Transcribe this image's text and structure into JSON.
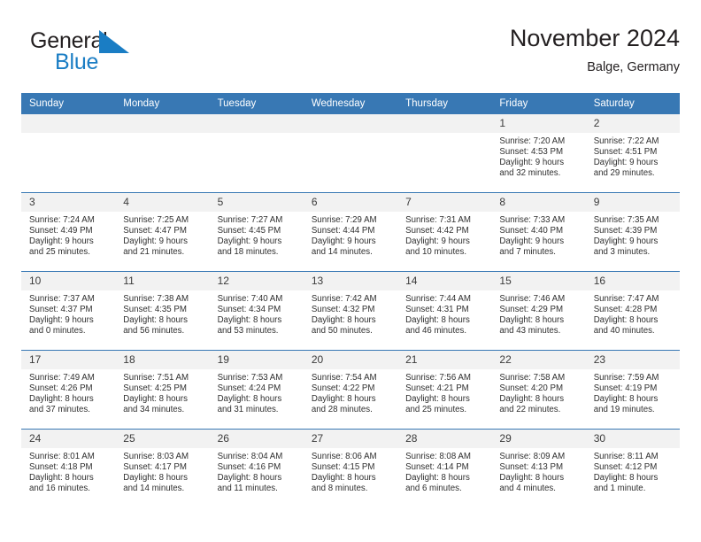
{
  "brand": {
    "name_part1": "General",
    "name_part2": "Blue",
    "logo_icon": "blue-triangle-icon",
    "accent_color": "#1a7dc4"
  },
  "header": {
    "title": "November 2024",
    "subtitle": "Balge, Germany"
  },
  "calendar": {
    "header_bg_color": "#3878b4",
    "daynum_bg_color": "#f2f2f2",
    "weekdays": [
      "Sunday",
      "Monday",
      "Tuesday",
      "Wednesday",
      "Thursday",
      "Friday",
      "Saturday"
    ],
    "weeks": [
      [
        {
          "day": "",
          "empty": true
        },
        {
          "day": "",
          "empty": true
        },
        {
          "day": "",
          "empty": true
        },
        {
          "day": "",
          "empty": true
        },
        {
          "day": "",
          "empty": true
        },
        {
          "day": "1",
          "sunrise": "Sunrise: 7:20 AM",
          "sunset": "Sunset: 4:53 PM",
          "daylight_1": "Daylight: 9 hours",
          "daylight_2": "and 32 minutes."
        },
        {
          "day": "2",
          "sunrise": "Sunrise: 7:22 AM",
          "sunset": "Sunset: 4:51 PM",
          "daylight_1": "Daylight: 9 hours",
          "daylight_2": "and 29 minutes."
        }
      ],
      [
        {
          "day": "3",
          "sunrise": "Sunrise: 7:24 AM",
          "sunset": "Sunset: 4:49 PM",
          "daylight_1": "Daylight: 9 hours",
          "daylight_2": "and 25 minutes."
        },
        {
          "day": "4",
          "sunrise": "Sunrise: 7:25 AM",
          "sunset": "Sunset: 4:47 PM",
          "daylight_1": "Daylight: 9 hours",
          "daylight_2": "and 21 minutes."
        },
        {
          "day": "5",
          "sunrise": "Sunrise: 7:27 AM",
          "sunset": "Sunset: 4:45 PM",
          "daylight_1": "Daylight: 9 hours",
          "daylight_2": "and 18 minutes."
        },
        {
          "day": "6",
          "sunrise": "Sunrise: 7:29 AM",
          "sunset": "Sunset: 4:44 PM",
          "daylight_1": "Daylight: 9 hours",
          "daylight_2": "and 14 minutes."
        },
        {
          "day": "7",
          "sunrise": "Sunrise: 7:31 AM",
          "sunset": "Sunset: 4:42 PM",
          "daylight_1": "Daylight: 9 hours",
          "daylight_2": "and 10 minutes."
        },
        {
          "day": "8",
          "sunrise": "Sunrise: 7:33 AM",
          "sunset": "Sunset: 4:40 PM",
          "daylight_1": "Daylight: 9 hours",
          "daylight_2": "and 7 minutes."
        },
        {
          "day": "9",
          "sunrise": "Sunrise: 7:35 AM",
          "sunset": "Sunset: 4:39 PM",
          "daylight_1": "Daylight: 9 hours",
          "daylight_2": "and 3 minutes."
        }
      ],
      [
        {
          "day": "10",
          "sunrise": "Sunrise: 7:37 AM",
          "sunset": "Sunset: 4:37 PM",
          "daylight_1": "Daylight: 9 hours",
          "daylight_2": "and 0 minutes."
        },
        {
          "day": "11",
          "sunrise": "Sunrise: 7:38 AM",
          "sunset": "Sunset: 4:35 PM",
          "daylight_1": "Daylight: 8 hours",
          "daylight_2": "and 56 minutes."
        },
        {
          "day": "12",
          "sunrise": "Sunrise: 7:40 AM",
          "sunset": "Sunset: 4:34 PM",
          "daylight_1": "Daylight: 8 hours",
          "daylight_2": "and 53 minutes."
        },
        {
          "day": "13",
          "sunrise": "Sunrise: 7:42 AM",
          "sunset": "Sunset: 4:32 PM",
          "daylight_1": "Daylight: 8 hours",
          "daylight_2": "and 50 minutes."
        },
        {
          "day": "14",
          "sunrise": "Sunrise: 7:44 AM",
          "sunset": "Sunset: 4:31 PM",
          "daylight_1": "Daylight: 8 hours",
          "daylight_2": "and 46 minutes."
        },
        {
          "day": "15",
          "sunrise": "Sunrise: 7:46 AM",
          "sunset": "Sunset: 4:29 PM",
          "daylight_1": "Daylight: 8 hours",
          "daylight_2": "and 43 minutes."
        },
        {
          "day": "16",
          "sunrise": "Sunrise: 7:47 AM",
          "sunset": "Sunset: 4:28 PM",
          "daylight_1": "Daylight: 8 hours",
          "daylight_2": "and 40 minutes."
        }
      ],
      [
        {
          "day": "17",
          "sunrise": "Sunrise: 7:49 AM",
          "sunset": "Sunset: 4:26 PM",
          "daylight_1": "Daylight: 8 hours",
          "daylight_2": "and 37 minutes."
        },
        {
          "day": "18",
          "sunrise": "Sunrise: 7:51 AM",
          "sunset": "Sunset: 4:25 PM",
          "daylight_1": "Daylight: 8 hours",
          "daylight_2": "and 34 minutes."
        },
        {
          "day": "19",
          "sunrise": "Sunrise: 7:53 AM",
          "sunset": "Sunset: 4:24 PM",
          "daylight_1": "Daylight: 8 hours",
          "daylight_2": "and 31 minutes."
        },
        {
          "day": "20",
          "sunrise": "Sunrise: 7:54 AM",
          "sunset": "Sunset: 4:22 PM",
          "daylight_1": "Daylight: 8 hours",
          "daylight_2": "and 28 minutes."
        },
        {
          "day": "21",
          "sunrise": "Sunrise: 7:56 AM",
          "sunset": "Sunset: 4:21 PM",
          "daylight_1": "Daylight: 8 hours",
          "daylight_2": "and 25 minutes."
        },
        {
          "day": "22",
          "sunrise": "Sunrise: 7:58 AM",
          "sunset": "Sunset: 4:20 PM",
          "daylight_1": "Daylight: 8 hours",
          "daylight_2": "and 22 minutes."
        },
        {
          "day": "23",
          "sunrise": "Sunrise: 7:59 AM",
          "sunset": "Sunset: 4:19 PM",
          "daylight_1": "Daylight: 8 hours",
          "daylight_2": "and 19 minutes."
        }
      ],
      [
        {
          "day": "24",
          "sunrise": "Sunrise: 8:01 AM",
          "sunset": "Sunset: 4:18 PM",
          "daylight_1": "Daylight: 8 hours",
          "daylight_2": "and 16 minutes."
        },
        {
          "day": "25",
          "sunrise": "Sunrise: 8:03 AM",
          "sunset": "Sunset: 4:17 PM",
          "daylight_1": "Daylight: 8 hours",
          "daylight_2": "and 14 minutes."
        },
        {
          "day": "26",
          "sunrise": "Sunrise: 8:04 AM",
          "sunset": "Sunset: 4:16 PM",
          "daylight_1": "Daylight: 8 hours",
          "daylight_2": "and 11 minutes."
        },
        {
          "day": "27",
          "sunrise": "Sunrise: 8:06 AM",
          "sunset": "Sunset: 4:15 PM",
          "daylight_1": "Daylight: 8 hours",
          "daylight_2": "and 8 minutes."
        },
        {
          "day": "28",
          "sunrise": "Sunrise: 8:08 AM",
          "sunset": "Sunset: 4:14 PM",
          "daylight_1": "Daylight: 8 hours",
          "daylight_2": "and 6 minutes."
        },
        {
          "day": "29",
          "sunrise": "Sunrise: 8:09 AM",
          "sunset": "Sunset: 4:13 PM",
          "daylight_1": "Daylight: 8 hours",
          "daylight_2": "and 4 minutes."
        },
        {
          "day": "30",
          "sunrise": "Sunrise: 8:11 AM",
          "sunset": "Sunset: 4:12 PM",
          "daylight_1": "Daylight: 8 hours",
          "daylight_2": "and 1 minute."
        }
      ]
    ]
  }
}
